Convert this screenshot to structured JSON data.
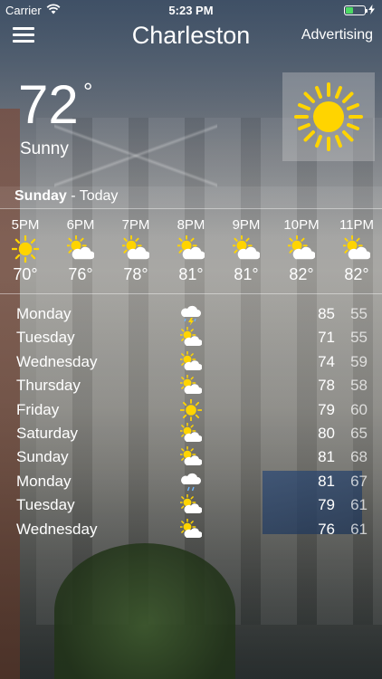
{
  "status_bar": {
    "carrier": "Carrier",
    "time": "5:23 PM"
  },
  "nav": {
    "city": "Charleston",
    "advertising_label": "Advertising"
  },
  "current": {
    "temperature": "72",
    "degree_symbol": "°",
    "condition": "Sunny",
    "icon": "sun-icon"
  },
  "day_header": {
    "day": "Sunday",
    "suffix": " - Today"
  },
  "hourly": [
    {
      "time": "5PM",
      "temp": "70°",
      "icon": "sun-icon"
    },
    {
      "time": "6PM",
      "temp": "76°",
      "icon": "partly-sunny-icon"
    },
    {
      "time": "7PM",
      "temp": "78°",
      "icon": "partly-sunny-icon"
    },
    {
      "time": "8PM",
      "temp": "81°",
      "icon": "partly-sunny-icon"
    },
    {
      "time": "9PM",
      "temp": "81°",
      "icon": "partly-sunny-icon"
    },
    {
      "time": "10PM",
      "temp": "82°",
      "icon": "partly-sunny-icon"
    },
    {
      "time": "11PM",
      "temp": "82°",
      "icon": "partly-sunny-icon"
    }
  ],
  "daily": [
    {
      "day": "Monday",
      "high": "85",
      "low": "55",
      "icon": "thunderstorm-icon"
    },
    {
      "day": "Tuesday",
      "high": "71",
      "low": "55",
      "icon": "partly-sunny-icon"
    },
    {
      "day": "Wednesday",
      "high": "74",
      "low": "59",
      "icon": "partly-sunny-icon"
    },
    {
      "day": "Thursday",
      "high": "78",
      "low": "58",
      "icon": "partly-sunny-icon"
    },
    {
      "day": "Friday",
      "high": "79",
      "low": "60",
      "icon": "sun-icon"
    },
    {
      "day": "Saturday",
      "high": "80",
      "low": "65",
      "icon": "partly-sunny-icon"
    },
    {
      "day": "Sunday",
      "high": "81",
      "low": "68",
      "icon": "partly-sunny-icon"
    },
    {
      "day": "Monday",
      "high": "81",
      "low": "67",
      "icon": "rain-icon"
    },
    {
      "day": "Tuesday",
      "high": "79",
      "low": "61",
      "icon": "partly-sunny-icon"
    },
    {
      "day": "Wednesday",
      "high": "76",
      "low": "61",
      "icon": "partly-sunny-icon"
    }
  ],
  "colors": {
    "sun": "#ffd400",
    "battery": "#4cd964",
    "rain": "#6fb8ff"
  }
}
